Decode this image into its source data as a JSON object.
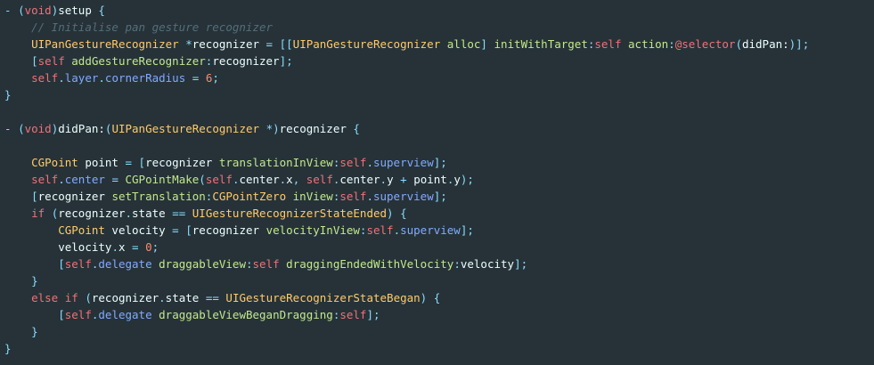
{
  "editor": {
    "language": "Objective-C",
    "colors": {
      "background": "#263238",
      "punctuation": "#89DDFF",
      "type": "#FFCB6B",
      "method": "#C3E88D",
      "keyword": "#F07178",
      "property": "#82AAFF",
      "comment": "#546E7A",
      "number": "#F78C6C",
      "text": "#EEFFFF"
    },
    "lines": [
      [
        [
          "punct",
          "- "
        ],
        [
          "punct",
          "("
        ],
        [
          "keyword",
          "void"
        ],
        [
          "punct",
          ")"
        ],
        [
          "text",
          "setup "
        ],
        [
          "punct",
          "{"
        ]
      ],
      [
        [
          "text",
          "    "
        ],
        [
          "comment",
          "// Initialise pan gesture recognizer"
        ]
      ],
      [
        [
          "text",
          "    "
        ],
        [
          "type",
          "UIPanGestureRecognizer"
        ],
        [
          "text",
          " "
        ],
        [
          "punct",
          "*"
        ],
        [
          "text",
          "recognizer "
        ],
        [
          "punct",
          "="
        ],
        [
          "text",
          " "
        ],
        [
          "punct",
          "[["
        ],
        [
          "type",
          "UIPanGestureRecognizer"
        ],
        [
          "text",
          " "
        ],
        [
          "method",
          "alloc"
        ],
        [
          "punct",
          "]"
        ],
        [
          "text",
          " "
        ],
        [
          "method",
          "initWithTarget"
        ],
        [
          "punct",
          ":"
        ],
        [
          "keyword",
          "self"
        ],
        [
          "text",
          " "
        ],
        [
          "method",
          "action"
        ],
        [
          "punct",
          ":"
        ],
        [
          "keyword",
          "@selector"
        ],
        [
          "punct",
          "("
        ],
        [
          "text",
          "didPan:"
        ],
        [
          "punct",
          ")];"
        ]
      ],
      [
        [
          "text",
          "    "
        ],
        [
          "punct",
          "["
        ],
        [
          "keyword",
          "self"
        ],
        [
          "text",
          " "
        ],
        [
          "method",
          "addGestureRecognizer"
        ],
        [
          "punct",
          ":"
        ],
        [
          "text",
          "recognizer"
        ],
        [
          "punct",
          "];"
        ]
      ],
      [
        [
          "text",
          "    "
        ],
        [
          "keyword",
          "self"
        ],
        [
          "punct",
          "."
        ],
        [
          "prop",
          "layer"
        ],
        [
          "punct",
          "."
        ],
        [
          "prop",
          "cornerRadius"
        ],
        [
          "text",
          " "
        ],
        [
          "punct",
          "="
        ],
        [
          "text",
          " "
        ],
        [
          "number",
          "6"
        ],
        [
          "punct",
          ";"
        ]
      ],
      [
        [
          "punct",
          "}"
        ]
      ],
      [],
      [
        [
          "punct",
          "- "
        ],
        [
          "punct",
          "("
        ],
        [
          "keyword",
          "void"
        ],
        [
          "punct",
          ")"
        ],
        [
          "text",
          "didPan:"
        ],
        [
          "punct",
          "("
        ],
        [
          "type",
          "UIPanGestureRecognizer"
        ],
        [
          "text",
          " "
        ],
        [
          "punct",
          "*)"
        ],
        [
          "text",
          "recognizer "
        ],
        [
          "punct",
          "{"
        ]
      ],
      [],
      [
        [
          "text",
          "    "
        ],
        [
          "type",
          "CGPoint"
        ],
        [
          "text",
          " point "
        ],
        [
          "punct",
          "="
        ],
        [
          "text",
          " "
        ],
        [
          "punct",
          "["
        ],
        [
          "text",
          "recognizer "
        ],
        [
          "method",
          "translationInView"
        ],
        [
          "punct",
          ":"
        ],
        [
          "keyword",
          "self"
        ],
        [
          "punct",
          "."
        ],
        [
          "prop",
          "superview"
        ],
        [
          "punct",
          "];"
        ]
      ],
      [
        [
          "text",
          "    "
        ],
        [
          "keyword",
          "self"
        ],
        [
          "punct",
          "."
        ],
        [
          "prop",
          "center"
        ],
        [
          "text",
          " "
        ],
        [
          "punct",
          "="
        ],
        [
          "text",
          " "
        ],
        [
          "method",
          "CGPointMake"
        ],
        [
          "punct",
          "("
        ],
        [
          "keyword",
          "self"
        ],
        [
          "punct",
          "."
        ],
        [
          "text",
          "center"
        ],
        [
          "punct",
          "."
        ],
        [
          "text",
          "x"
        ],
        [
          "punct",
          ","
        ],
        [
          "text",
          " "
        ],
        [
          "keyword",
          "self"
        ],
        [
          "punct",
          "."
        ],
        [
          "text",
          "center"
        ],
        [
          "punct",
          "."
        ],
        [
          "text",
          "y "
        ],
        [
          "punct",
          "+"
        ],
        [
          "text",
          " point"
        ],
        [
          "punct",
          "."
        ],
        [
          "text",
          "y"
        ],
        [
          "punct",
          ");"
        ]
      ],
      [
        [
          "text",
          "    "
        ],
        [
          "punct",
          "["
        ],
        [
          "text",
          "recognizer "
        ],
        [
          "method",
          "setTranslation"
        ],
        [
          "punct",
          ":"
        ],
        [
          "type",
          "CGPointZero"
        ],
        [
          "text",
          " "
        ],
        [
          "method",
          "inView"
        ],
        [
          "punct",
          ":"
        ],
        [
          "keyword",
          "self"
        ],
        [
          "punct",
          "."
        ],
        [
          "prop",
          "superview"
        ],
        [
          "punct",
          "];"
        ]
      ],
      [
        [
          "text",
          "    "
        ],
        [
          "keyword",
          "if"
        ],
        [
          "text",
          " "
        ],
        [
          "punct",
          "("
        ],
        [
          "text",
          "recognizer"
        ],
        [
          "punct",
          "."
        ],
        [
          "text",
          "state "
        ],
        [
          "punct",
          "=="
        ],
        [
          "text",
          " "
        ],
        [
          "type",
          "UIGestureRecognizerStateEnded"
        ],
        [
          "punct",
          ")"
        ],
        [
          "text",
          " "
        ],
        [
          "punct",
          "{"
        ]
      ],
      [
        [
          "text",
          "        "
        ],
        [
          "type",
          "CGPoint"
        ],
        [
          "text",
          " velocity "
        ],
        [
          "punct",
          "="
        ],
        [
          "text",
          " "
        ],
        [
          "punct",
          "["
        ],
        [
          "text",
          "recognizer "
        ],
        [
          "method",
          "velocityInView"
        ],
        [
          "punct",
          ":"
        ],
        [
          "keyword",
          "self"
        ],
        [
          "punct",
          "."
        ],
        [
          "prop",
          "superview"
        ],
        [
          "punct",
          "];"
        ]
      ],
      [
        [
          "text",
          "        "
        ],
        [
          "text",
          "velocity"
        ],
        [
          "punct",
          "."
        ],
        [
          "text",
          "x "
        ],
        [
          "punct",
          "="
        ],
        [
          "text",
          " "
        ],
        [
          "number",
          "0"
        ],
        [
          "punct",
          ";"
        ]
      ],
      [
        [
          "text",
          "        "
        ],
        [
          "punct",
          "["
        ],
        [
          "keyword",
          "self"
        ],
        [
          "punct",
          "."
        ],
        [
          "prop",
          "delegate"
        ],
        [
          "text",
          " "
        ],
        [
          "method",
          "draggableView"
        ],
        [
          "punct",
          ":"
        ],
        [
          "keyword",
          "self"
        ],
        [
          "text",
          " "
        ],
        [
          "method",
          "draggingEndedWithVelocity"
        ],
        [
          "punct",
          ":"
        ],
        [
          "text",
          "velocity"
        ],
        [
          "punct",
          "];"
        ]
      ],
      [
        [
          "text",
          "    "
        ],
        [
          "punct",
          "}"
        ]
      ],
      [
        [
          "text",
          "    "
        ],
        [
          "keyword",
          "else"
        ],
        [
          "text",
          " "
        ],
        [
          "keyword",
          "if"
        ],
        [
          "text",
          " "
        ],
        [
          "punct",
          "("
        ],
        [
          "text",
          "recognizer"
        ],
        [
          "punct",
          "."
        ],
        [
          "text",
          "state "
        ],
        [
          "punct",
          "=="
        ],
        [
          "text",
          " "
        ],
        [
          "type",
          "UIGestureRecognizerStateBegan"
        ],
        [
          "punct",
          ")"
        ],
        [
          "text",
          " "
        ],
        [
          "punct",
          "{"
        ]
      ],
      [
        [
          "text",
          "        "
        ],
        [
          "punct",
          "["
        ],
        [
          "keyword",
          "self"
        ],
        [
          "punct",
          "."
        ],
        [
          "prop",
          "delegate"
        ],
        [
          "text",
          " "
        ],
        [
          "method",
          "draggableViewBeganDragging"
        ],
        [
          "punct",
          ":"
        ],
        [
          "keyword",
          "self"
        ],
        [
          "punct",
          "];"
        ]
      ],
      [
        [
          "text",
          "    "
        ],
        [
          "punct",
          "}"
        ]
      ],
      [
        [
          "punct",
          "}"
        ]
      ]
    ]
  }
}
